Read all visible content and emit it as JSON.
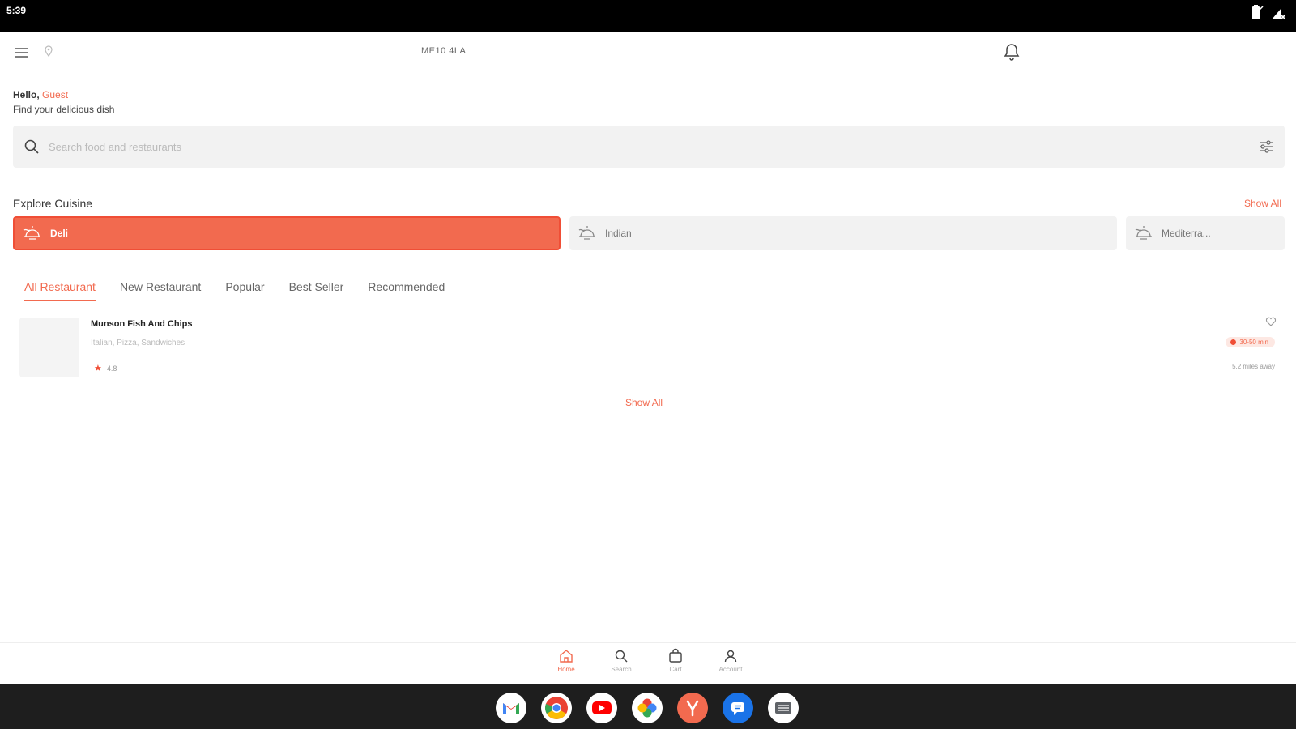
{
  "status_bar": {
    "time": "5:39"
  },
  "header": {
    "location": "ME10 4LA",
    "icons": {
      "menu": "hamburger-menu-icon",
      "pin": "location-pin-icon",
      "notifications": "bell-icon"
    }
  },
  "greeting": {
    "hello": "Hello, ",
    "name": "Guest",
    "subtitle": "Find your delicious dish"
  },
  "search": {
    "placeholder": "Search food and restaurants",
    "value": ""
  },
  "cuisine_section": {
    "title": "Explore Cuisine",
    "show_all": "Show All",
    "items": [
      {
        "label": "Deli",
        "active": true
      },
      {
        "label": "Indian",
        "active": false
      },
      {
        "label": "Mediterra...",
        "active": false
      }
    ]
  },
  "tabs": [
    "All Restaurant",
    "New Restaurant",
    "Popular",
    "Best Seller",
    "Recommended"
  ],
  "active_tab": "All Restaurant",
  "restaurants": [
    {
      "name": "Munson Fish And Chips",
      "cuisines": "Italian, Pizza, Sandwiches",
      "rating": "4.8",
      "delivery_time": "30-50 min",
      "distance": "5.2 miles away"
    }
  ],
  "show_all_restaurants": "Show All",
  "bottom_nav": [
    {
      "label": "Home",
      "icon": "home-icon",
      "active": true
    },
    {
      "label": "Search",
      "icon": "search-icon",
      "active": false
    },
    {
      "label": "Cart",
      "icon": "cart-icon",
      "active": false
    },
    {
      "label": "Account",
      "icon": "account-icon",
      "active": false
    }
  ],
  "dock": [
    "gmail",
    "chrome",
    "youtube",
    "photos",
    "food-app",
    "messages",
    "files"
  ],
  "colors": {
    "accent": "#f26a4f",
    "accent_dark": "#f04e36",
    "light_bg": "#f2f2f2",
    "taskbar": "#1e1e1e"
  }
}
